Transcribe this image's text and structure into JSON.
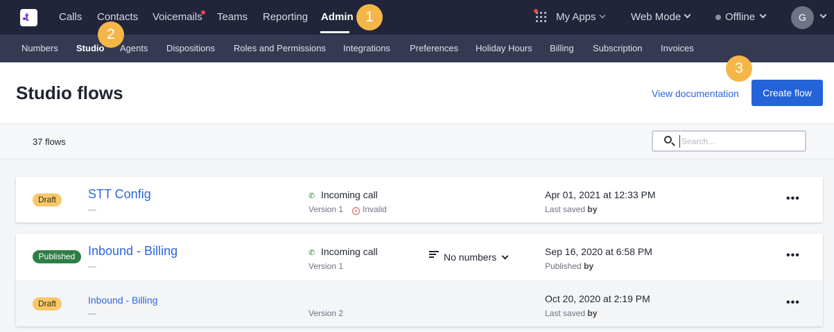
{
  "topnav": {
    "items": [
      "Calls",
      "Contacts",
      "Voicemails",
      "Teams",
      "Reporting",
      "Admin"
    ],
    "active": "Admin",
    "my_apps": "My Apps",
    "mode": "Web Mode",
    "status": "Offline",
    "avatar_initial": "G"
  },
  "callouts": [
    "1",
    "2",
    "3"
  ],
  "subnav": {
    "items": [
      "Numbers",
      "Studio",
      "Agents",
      "Dispositions",
      "Roles and Permissions",
      "Integrations",
      "Preferences",
      "Holiday Hours",
      "Billing",
      "Subscription",
      "Invoices"
    ],
    "active": "Studio"
  },
  "header": {
    "title": "Studio flows",
    "view_doc": "View documentation",
    "create_flow": "Create flow"
  },
  "filter": {
    "count": "37 flows",
    "search_placeholder": "Search..."
  },
  "flows": [
    {
      "status": "Draft",
      "name": "STT Config",
      "dash": "—",
      "trigger": "Incoming call",
      "version": "Version 1",
      "validity": "Invalid",
      "date": "Apr 01, 2021 at 12:33 PM",
      "saved_label": "Last saved",
      "saved_by": "by"
    },
    {
      "status": "Published",
      "name": "Inbound - Billing",
      "dash": "—",
      "trigger": "Incoming call",
      "version": "Version 1",
      "numbers": "No numbers",
      "date": "Sep 16, 2020 at 6:58 PM",
      "saved_label": "Published",
      "saved_by": "by"
    },
    {
      "status": "Draft",
      "name": "Inbound - Billing",
      "dash": "—",
      "version": "Version 2",
      "date": "Oct 20, 2020 at 2:19 PM",
      "saved_label": "Last saved",
      "saved_by": "by"
    }
  ],
  "colors": {
    "topbar": "#21253a",
    "subbar": "#353a52",
    "accent": "#2463d8",
    "callout": "#f5b649",
    "draft": "#f6c86a",
    "published": "#2e7d46"
  },
  "icons": [
    "logo-icon",
    "grid-apps-icon",
    "chevron-down-icon",
    "status-dot-icon",
    "search-icon",
    "phone-icon",
    "invalid-icon",
    "numbers-list-icon",
    "more-icon"
  ]
}
